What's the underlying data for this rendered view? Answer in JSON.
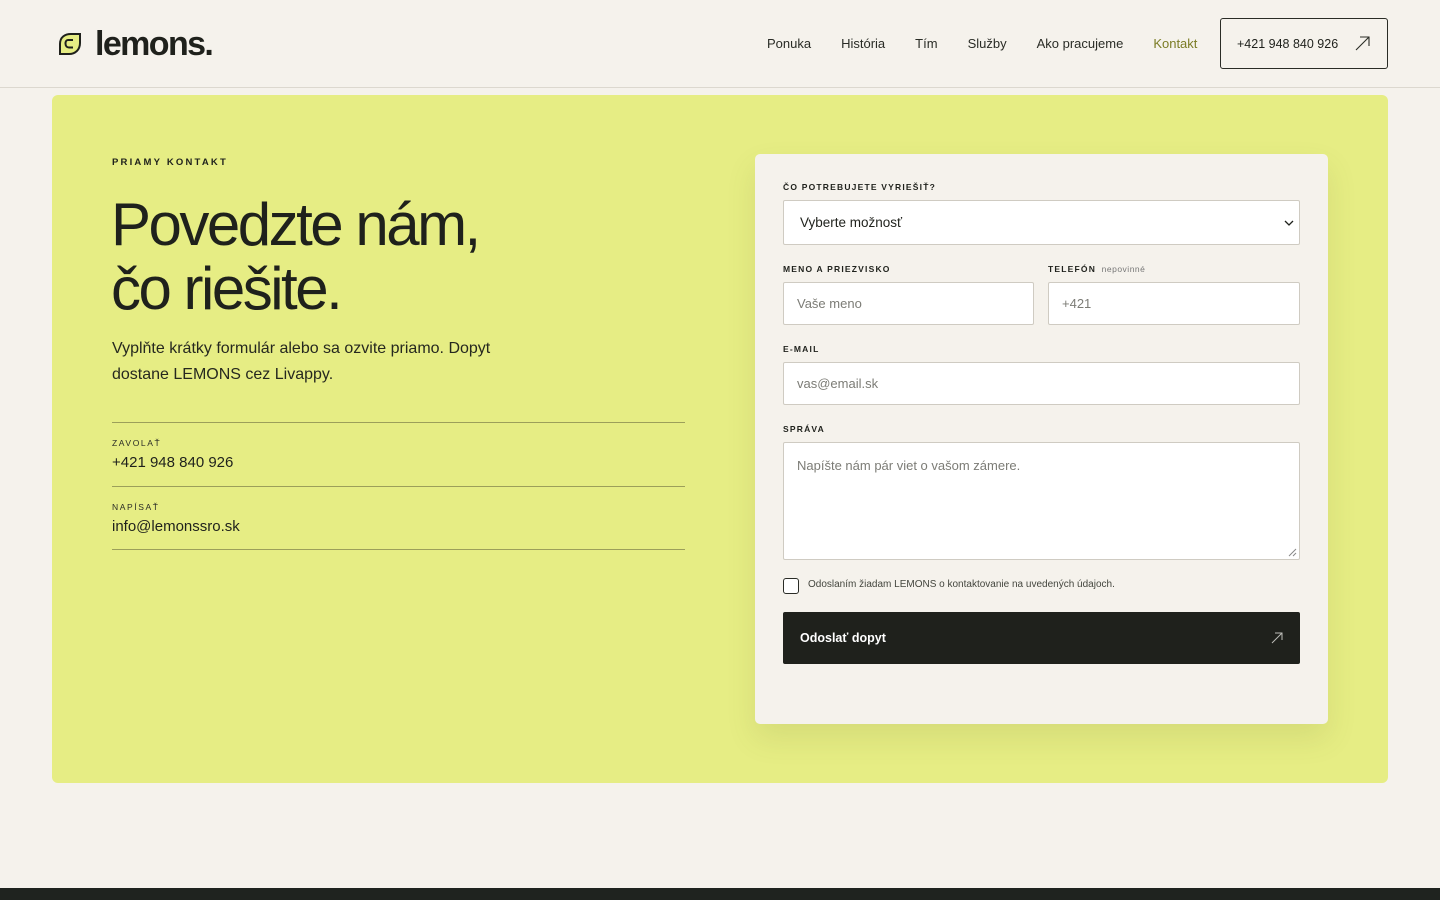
{
  "brand": {
    "logo_text": "lemons.",
    "logo_icon": "lemon-logo-icon",
    "accent": "#e6ed84",
    "dark": "#1f211c",
    "background": "#f5f2ec"
  },
  "nav": {
    "items": [
      {
        "label": "Ponuka"
      },
      {
        "label": "História"
      },
      {
        "label": "Tím"
      },
      {
        "label": "Služby"
      },
      {
        "label": "Ako pracujeme"
      },
      {
        "label": "Kontakt",
        "active": true
      }
    ],
    "active_color": "#7b7c25",
    "phone_button": {
      "label": "+421 948 840 926",
      "icon": "arrow-up-right-icon"
    }
  },
  "hero": {
    "eyebrow": "PRIAMY KONTAKT",
    "headline_line1": "Povedzte nám,",
    "headline_line2": "čo riešite.",
    "lead": "Vyplňte krátky formulár alebo sa ozvite priamo. Dopyt dostane LEMONS cez Livappy.",
    "contacts": [
      {
        "label": "ZAVOLAŤ",
        "value": "+421 948 840 926"
      },
      {
        "label": "NAPÍSAŤ",
        "value": "info@lemonssro.sk"
      }
    ]
  },
  "form": {
    "topic": {
      "label": "ČO POTREBUJETE VYRIEŠIŤ?",
      "selected": "Vyberte možnosť",
      "icon": "chevron-down-icon"
    },
    "name": {
      "label": "MENO A PRIEZVISKO",
      "placeholder": "Vaše meno"
    },
    "phone": {
      "label": "TELEFÓN",
      "optional": "nepovinné",
      "placeholder": "+421"
    },
    "email": {
      "label": "E-MAIL",
      "placeholder": "vas@email.sk"
    },
    "message": {
      "label": "SPRÁVA",
      "placeholder": "Napíšte nám pár viet o vašom zámere."
    },
    "consent": {
      "text": "Odoslaním žiadam LEMONS o kontaktovanie na uvedených údajoch.",
      "checked": false
    },
    "submit": {
      "label": "Odoslať dopyt",
      "icon": "arrow-up-right-icon"
    }
  }
}
